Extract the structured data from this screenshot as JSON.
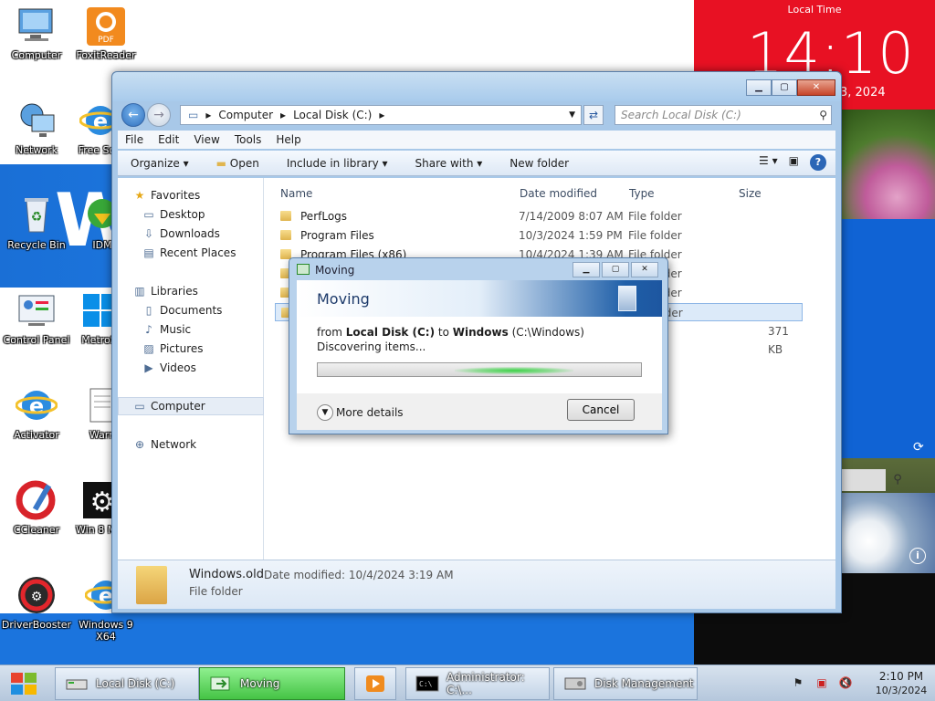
{
  "desktop": {
    "icons": [
      {
        "label": "Computer",
        "x": 0,
        "y": 0
      },
      {
        "label": "FoxitReader"
      },
      {
        "label": "Network"
      },
      {
        "label": "Free Soft"
      },
      {
        "label": "Recycle Bin"
      },
      {
        "label": "IDM"
      },
      {
        "label": "Control Panel"
      },
      {
        "label": "MetroSi"
      },
      {
        "label": "Activator"
      },
      {
        "label": "Warn"
      },
      {
        "label": "CCleaner"
      },
      {
        "label": "Win 8\nMen"
      },
      {
        "label": "DriverBooster"
      },
      {
        "label": "Windows 9 X64"
      }
    ],
    "logo_text": "W"
  },
  "metro": {
    "local_time_label": "Local Time",
    "time": "14:10",
    "date_partial": "3, 2024",
    "refresh_icon": "refresh-icon",
    "search_icon": "search-icon",
    "info_icon": "info-icon"
  },
  "explorer": {
    "caption_minimize": "▁",
    "caption_maximize": "▢",
    "caption_close": "✕",
    "breadcrumb": [
      "Computer",
      "Local Disk (C:)"
    ],
    "search_placeholder": "Search Local Disk (C:)",
    "menu": [
      "File",
      "Edit",
      "View",
      "Tools",
      "Help"
    ],
    "toolbar": {
      "organize": "Organize ▾",
      "open": "Open",
      "include_in_library": "Include in library ▾",
      "share_with": "Share with ▾",
      "new_folder": "New folder"
    },
    "nav": {
      "favorites": "Favorites",
      "desktop": "Desktop",
      "downloads": "Downloads",
      "recent_places": "Recent Places",
      "libraries": "Libraries",
      "documents": "Documents",
      "music": "Music",
      "pictures": "Pictures",
      "videos": "Videos",
      "computer": "Computer",
      "network": "Network"
    },
    "columns": {
      "name": "Name",
      "date_modified": "Date modified",
      "type": "Type",
      "size": "Size"
    },
    "rows": [
      {
        "name": "PerfLogs",
        "date": "7/14/2009 8:07 AM",
        "type": "File folder",
        "size": ""
      },
      {
        "name": "Program Files",
        "date": "10/3/2024 1:59 PM",
        "type": "File folder",
        "size": ""
      },
      {
        "name": "Program Files (x86)",
        "date": "10/4/2024 1:39 AM",
        "type": "File folder",
        "size": ""
      },
      {
        "name": "",
        "date": "",
        "type": "File folder",
        "size": ""
      },
      {
        "name": "",
        "date": "",
        "type": "File folder",
        "size": ""
      },
      {
        "name": "",
        "date": "",
        "type": "File folder",
        "size": ""
      },
      {
        "name": "",
        "date": "",
        "type": "",
        "size": "371 KB"
      }
    ],
    "details": {
      "name": "Windows.old",
      "modified_label": "Date modified: 10/4/2024 3:19 AM",
      "type": "File folder"
    }
  },
  "moving_dialog": {
    "title": "Moving",
    "heading": "Moving",
    "from_prefix": "from ",
    "from_src": "Local Disk (C:)",
    "from_to": " to ",
    "from_dst": "Windows",
    "from_path": " (C:\\Windows)",
    "status": "Discovering items...",
    "more_details": "More details",
    "cancel": "Cancel"
  },
  "taskbar": {
    "items": [
      {
        "label": "Local Disk (C:)"
      },
      {
        "label": "Moving"
      },
      {
        "label": ""
      },
      {
        "label": "Administrator: C:\\..."
      },
      {
        "label": "Disk Management"
      }
    ],
    "clock_time": "2:10 PM",
    "clock_date": "10/3/2024"
  }
}
